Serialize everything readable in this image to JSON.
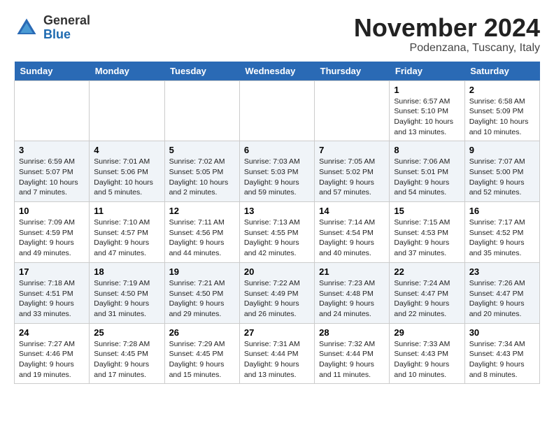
{
  "header": {
    "logo_general": "General",
    "logo_blue": "Blue",
    "month_title": "November 2024",
    "location": "Podenzana, Tuscany, Italy"
  },
  "weekdays": [
    "Sunday",
    "Monday",
    "Tuesday",
    "Wednesday",
    "Thursday",
    "Friday",
    "Saturday"
  ],
  "weeks": [
    [
      {
        "day": "",
        "info": ""
      },
      {
        "day": "",
        "info": ""
      },
      {
        "day": "",
        "info": ""
      },
      {
        "day": "",
        "info": ""
      },
      {
        "day": "",
        "info": ""
      },
      {
        "day": "1",
        "info": "Sunrise: 6:57 AM\nSunset: 5:10 PM\nDaylight: 10 hours\nand 13 minutes."
      },
      {
        "day": "2",
        "info": "Sunrise: 6:58 AM\nSunset: 5:09 PM\nDaylight: 10 hours\nand 10 minutes."
      }
    ],
    [
      {
        "day": "3",
        "info": "Sunrise: 6:59 AM\nSunset: 5:07 PM\nDaylight: 10 hours\nand 7 minutes."
      },
      {
        "day": "4",
        "info": "Sunrise: 7:01 AM\nSunset: 5:06 PM\nDaylight: 10 hours\nand 5 minutes."
      },
      {
        "day": "5",
        "info": "Sunrise: 7:02 AM\nSunset: 5:05 PM\nDaylight: 10 hours\nand 2 minutes."
      },
      {
        "day": "6",
        "info": "Sunrise: 7:03 AM\nSunset: 5:03 PM\nDaylight: 9 hours\nand 59 minutes."
      },
      {
        "day": "7",
        "info": "Sunrise: 7:05 AM\nSunset: 5:02 PM\nDaylight: 9 hours\nand 57 minutes."
      },
      {
        "day": "8",
        "info": "Sunrise: 7:06 AM\nSunset: 5:01 PM\nDaylight: 9 hours\nand 54 minutes."
      },
      {
        "day": "9",
        "info": "Sunrise: 7:07 AM\nSunset: 5:00 PM\nDaylight: 9 hours\nand 52 minutes."
      }
    ],
    [
      {
        "day": "10",
        "info": "Sunrise: 7:09 AM\nSunset: 4:59 PM\nDaylight: 9 hours\nand 49 minutes."
      },
      {
        "day": "11",
        "info": "Sunrise: 7:10 AM\nSunset: 4:57 PM\nDaylight: 9 hours\nand 47 minutes."
      },
      {
        "day": "12",
        "info": "Sunrise: 7:11 AM\nSunset: 4:56 PM\nDaylight: 9 hours\nand 44 minutes."
      },
      {
        "day": "13",
        "info": "Sunrise: 7:13 AM\nSunset: 4:55 PM\nDaylight: 9 hours\nand 42 minutes."
      },
      {
        "day": "14",
        "info": "Sunrise: 7:14 AM\nSunset: 4:54 PM\nDaylight: 9 hours\nand 40 minutes."
      },
      {
        "day": "15",
        "info": "Sunrise: 7:15 AM\nSunset: 4:53 PM\nDaylight: 9 hours\nand 37 minutes."
      },
      {
        "day": "16",
        "info": "Sunrise: 7:17 AM\nSunset: 4:52 PM\nDaylight: 9 hours\nand 35 minutes."
      }
    ],
    [
      {
        "day": "17",
        "info": "Sunrise: 7:18 AM\nSunset: 4:51 PM\nDaylight: 9 hours\nand 33 minutes."
      },
      {
        "day": "18",
        "info": "Sunrise: 7:19 AM\nSunset: 4:50 PM\nDaylight: 9 hours\nand 31 minutes."
      },
      {
        "day": "19",
        "info": "Sunrise: 7:21 AM\nSunset: 4:50 PM\nDaylight: 9 hours\nand 29 minutes."
      },
      {
        "day": "20",
        "info": "Sunrise: 7:22 AM\nSunset: 4:49 PM\nDaylight: 9 hours\nand 26 minutes."
      },
      {
        "day": "21",
        "info": "Sunrise: 7:23 AM\nSunset: 4:48 PM\nDaylight: 9 hours\nand 24 minutes."
      },
      {
        "day": "22",
        "info": "Sunrise: 7:24 AM\nSunset: 4:47 PM\nDaylight: 9 hours\nand 22 minutes."
      },
      {
        "day": "23",
        "info": "Sunrise: 7:26 AM\nSunset: 4:47 PM\nDaylight: 9 hours\nand 20 minutes."
      }
    ],
    [
      {
        "day": "24",
        "info": "Sunrise: 7:27 AM\nSunset: 4:46 PM\nDaylight: 9 hours\nand 19 minutes."
      },
      {
        "day": "25",
        "info": "Sunrise: 7:28 AM\nSunset: 4:45 PM\nDaylight: 9 hours\nand 17 minutes."
      },
      {
        "day": "26",
        "info": "Sunrise: 7:29 AM\nSunset: 4:45 PM\nDaylight: 9 hours\nand 15 minutes."
      },
      {
        "day": "27",
        "info": "Sunrise: 7:31 AM\nSunset: 4:44 PM\nDaylight: 9 hours\nand 13 minutes."
      },
      {
        "day": "28",
        "info": "Sunrise: 7:32 AM\nSunset: 4:44 PM\nDaylight: 9 hours\nand 11 minutes."
      },
      {
        "day": "29",
        "info": "Sunrise: 7:33 AM\nSunset: 4:43 PM\nDaylight: 9 hours\nand 10 minutes."
      },
      {
        "day": "30",
        "info": "Sunrise: 7:34 AM\nSunset: 4:43 PM\nDaylight: 9 hours\nand 8 minutes."
      }
    ]
  ]
}
